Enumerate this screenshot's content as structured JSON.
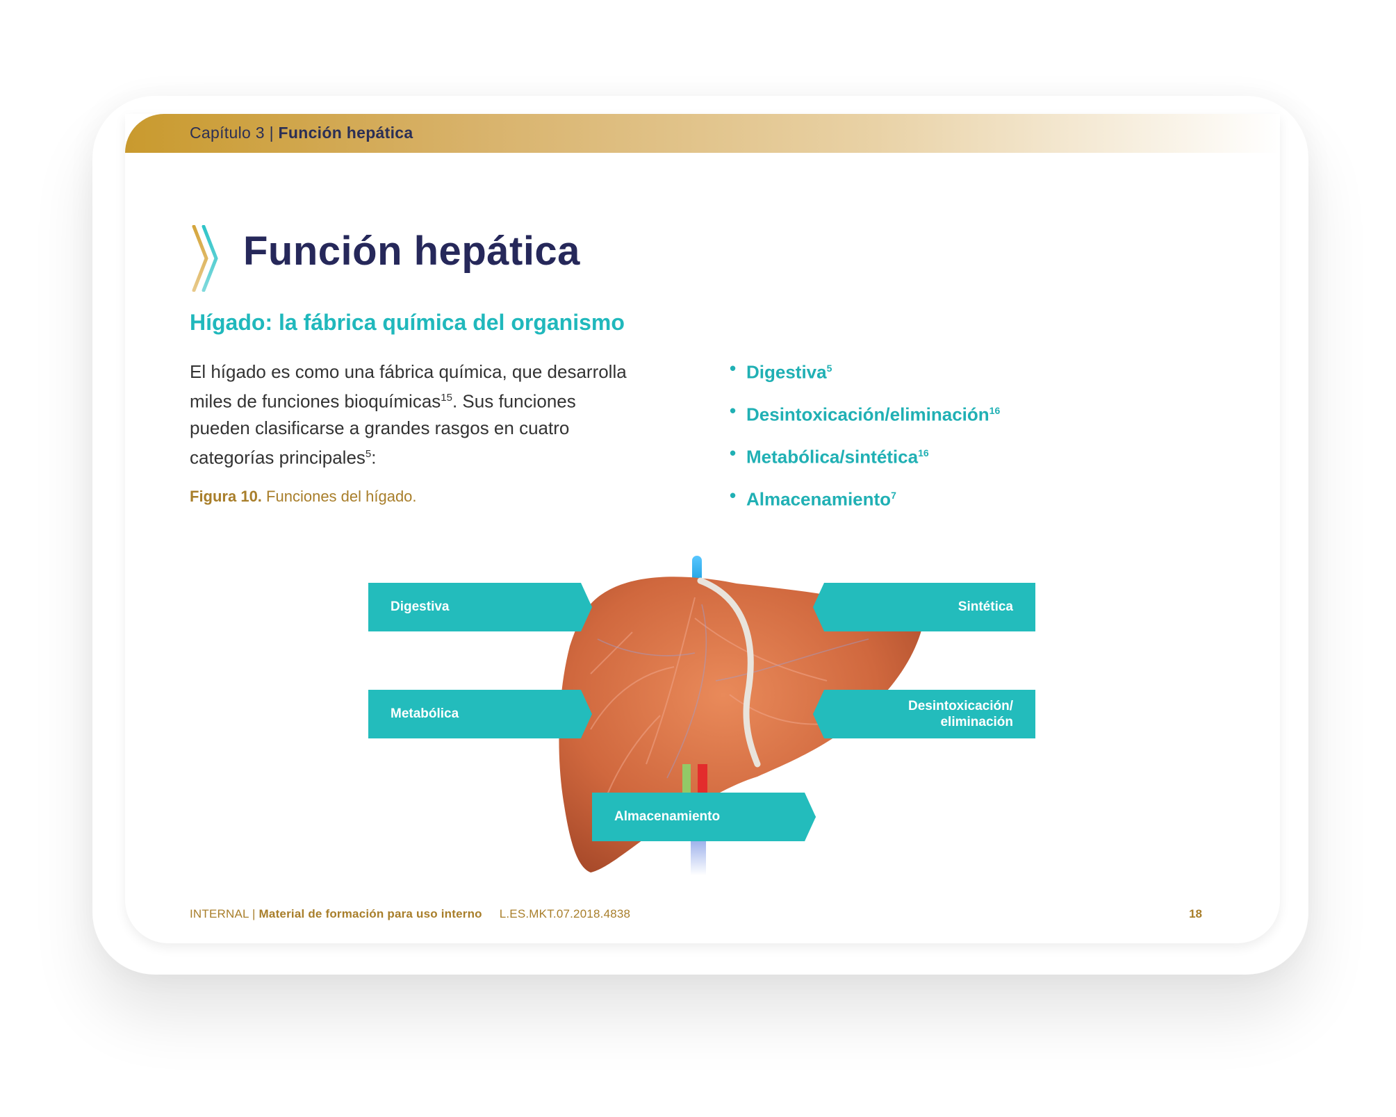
{
  "header": {
    "chapter": "Capítulo 3",
    "separator": "|",
    "section": "Función hepática"
  },
  "page": {
    "title": "Función hepática",
    "subtitle": "Hígado: la fábrica química del organismo",
    "body": {
      "line1": "El hígado es como una fábrica química, que desarrolla",
      "line2_pre": "miles de funciones bioquímicas",
      "line2_sup": "15",
      "line2_post": ". Sus funciones",
      "line3": "pueden clasificarse a grandes rasgos en cuatro",
      "line4_pre": "categorías principales",
      "line4_sup": "5",
      "line4_post": ":"
    },
    "figure_caption": {
      "label": "Figura 10.",
      "text": "Funciones del hígado."
    },
    "bullets": [
      {
        "text": "Digestiva",
        "sup": "5"
      },
      {
        "text": "Desintoxicación/eliminación",
        "sup": "16"
      },
      {
        "text": "Metabólica/sintética",
        "sup": "16"
      },
      {
        "text": "Almacenamiento",
        "sup": "7"
      }
    ]
  },
  "diagram_labels": {
    "digestiva": "Digestiva",
    "sintetica": "Sintética",
    "metabolica": "Metabólica",
    "desintox_line1": "Desintoxicación/",
    "desintox_line2": "eliminación",
    "almacenamiento": "Almacenamiento"
  },
  "footer": {
    "internal": "INTERNAL",
    "separator": "|",
    "material": "Material de formación para uso interno",
    "code": "L.ES.MKT.07.2018.4838",
    "page_number": "18"
  },
  "colors": {
    "navy": "#26285a",
    "teal": "#20b8bc",
    "gold": "#a87e2a",
    "liver": "#d0683e"
  }
}
